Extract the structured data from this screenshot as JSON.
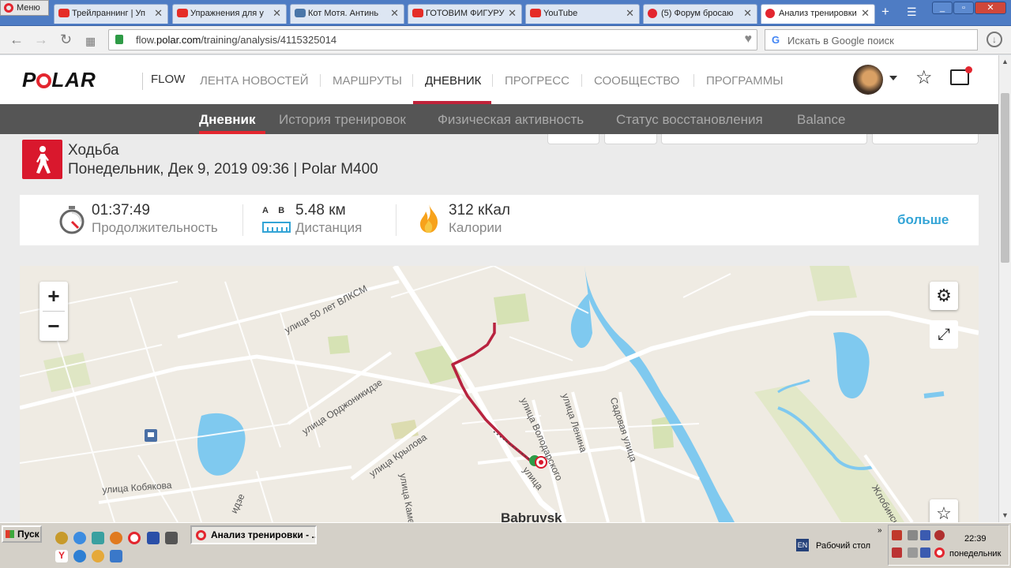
{
  "browser": {
    "menu_label": "Меню",
    "tabs": [
      {
        "label": "Трейлраннинг | Уп",
        "icon": "youtube-icon"
      },
      {
        "label": "Упражнения для у",
        "icon": "youtube-icon"
      },
      {
        "label": "Кот Мотя. Антинь",
        "icon": "vk-icon"
      },
      {
        "label": "ГОТОВИМ ФИГУРУ",
        "icon": "youtube-icon"
      },
      {
        "label": "YouTube",
        "icon": "youtube-icon"
      },
      {
        "label": "(5) Форум бросаю",
        "icon": "forum-icon"
      },
      {
        "label": "Анализ тренировки",
        "icon": "polar-icon",
        "active": true
      }
    ],
    "url_prefix": "flow.",
    "url_domain": "polar.com",
    "url_path": "/training/analysis/4115325014",
    "search_placeholder": "Искать в Google поиск"
  },
  "header": {
    "logo": "POLAR",
    "product": "FLOW",
    "nav": [
      {
        "label": "ЛЕНТА НОВОСТЕЙ"
      },
      {
        "label": "МАРШРУТЫ"
      },
      {
        "label": "ДНЕВНИК",
        "active": true
      },
      {
        "label": "ПРОГРЕСС"
      },
      {
        "label": "СООБЩЕСТВО"
      },
      {
        "label": "ПРОГРАММЫ"
      }
    ]
  },
  "subnav": [
    {
      "label": "Дневник",
      "active": true
    },
    {
      "label": "История тренировок"
    },
    {
      "label": "Физическая активность"
    },
    {
      "label": "Статус восстановления"
    },
    {
      "label": "Balance"
    }
  ],
  "training": {
    "sport": "Ходьба",
    "date_device": "Понедельник, Дек 9, 2019 09:36 | Polar M400"
  },
  "stats": {
    "duration": {
      "value": "01:37:49",
      "label": "Продолжительность"
    },
    "distance": {
      "value": "5.48 км",
      "label": "Дистанция",
      "a": "A",
      "b": "B"
    },
    "calories": {
      "value": "312 кКал",
      "label": "Калории"
    },
    "more": "больше"
  },
  "map": {
    "labels": {
      "vlksm": "улица 50 лет ВЛКСМ",
      "ordzh": "улица Орджоникидзе",
      "krylova": "улица Крылова",
      "kobyakova": "улица Кобякова",
      "volodarskogo": "улица Володарского",
      "lenina": "улица Ленина",
      "sadovaya": "Садовая улица",
      "zhlobinskaya": "Жлобинская",
      "kame": "улица Каме",
      "ulitsa": "улица",
      "idze": "идзе",
      "city": "Babruysk"
    },
    "colors": {
      "route": "#b8233f",
      "water": "#7fc9ef",
      "park": "#d6e2b4"
    }
  },
  "taskbar": {
    "start": "Пуск",
    "task": "Анализ тренировки - ...",
    "desktop": "Рабочий стол",
    "lang": "EN",
    "time": "22:39",
    "day": "понедельник"
  }
}
